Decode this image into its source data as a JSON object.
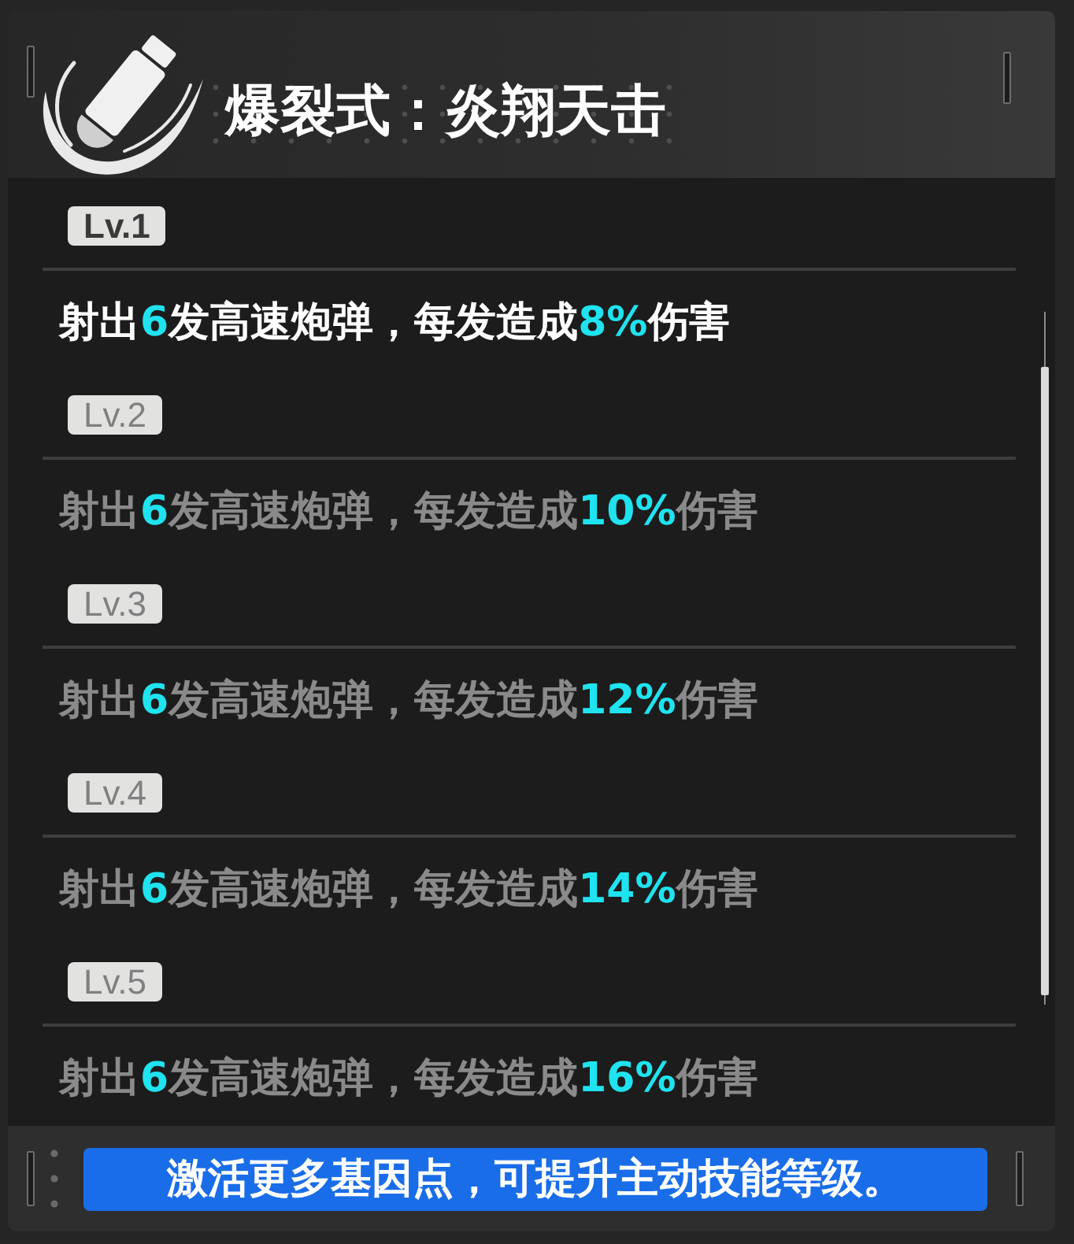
{
  "skill": {
    "title": "爆裂式：炎翔天击"
  },
  "rows": [
    {
      "kind": "level_tag",
      "label": "Lv.1",
      "active": true
    },
    {
      "kind": "description",
      "text": "射出**6**发高速炮弹，每发造成**8%**伤害",
      "active": true
    },
    {
      "kind": "level_tag",
      "label": "Lv.2",
      "active": false
    },
    {
      "kind": "description",
      "text": "射出**6**发高速炮弹，每发造成**10%**伤害",
      "active": false
    },
    {
      "kind": "level_tag",
      "label": "Lv.3",
      "active": false
    },
    {
      "kind": "description",
      "text": "射出**6**发高速炮弹，每发造成**12%**伤害",
      "active": false
    },
    {
      "kind": "level_tag",
      "label": "Lv.4",
      "active": false
    },
    {
      "kind": "description",
      "text": "射出**6**发高速炮弹，每发造成**14%**伤害",
      "active": false
    },
    {
      "kind": "level_tag",
      "label": "Lv.5",
      "active": false
    },
    {
      "kind": "description",
      "text": "射出**6**发高速炮弹，每发造成**16%**伤害",
      "active": false
    }
  ],
  "hint": "激活更多基因点，可提升主动技能等级。"
}
